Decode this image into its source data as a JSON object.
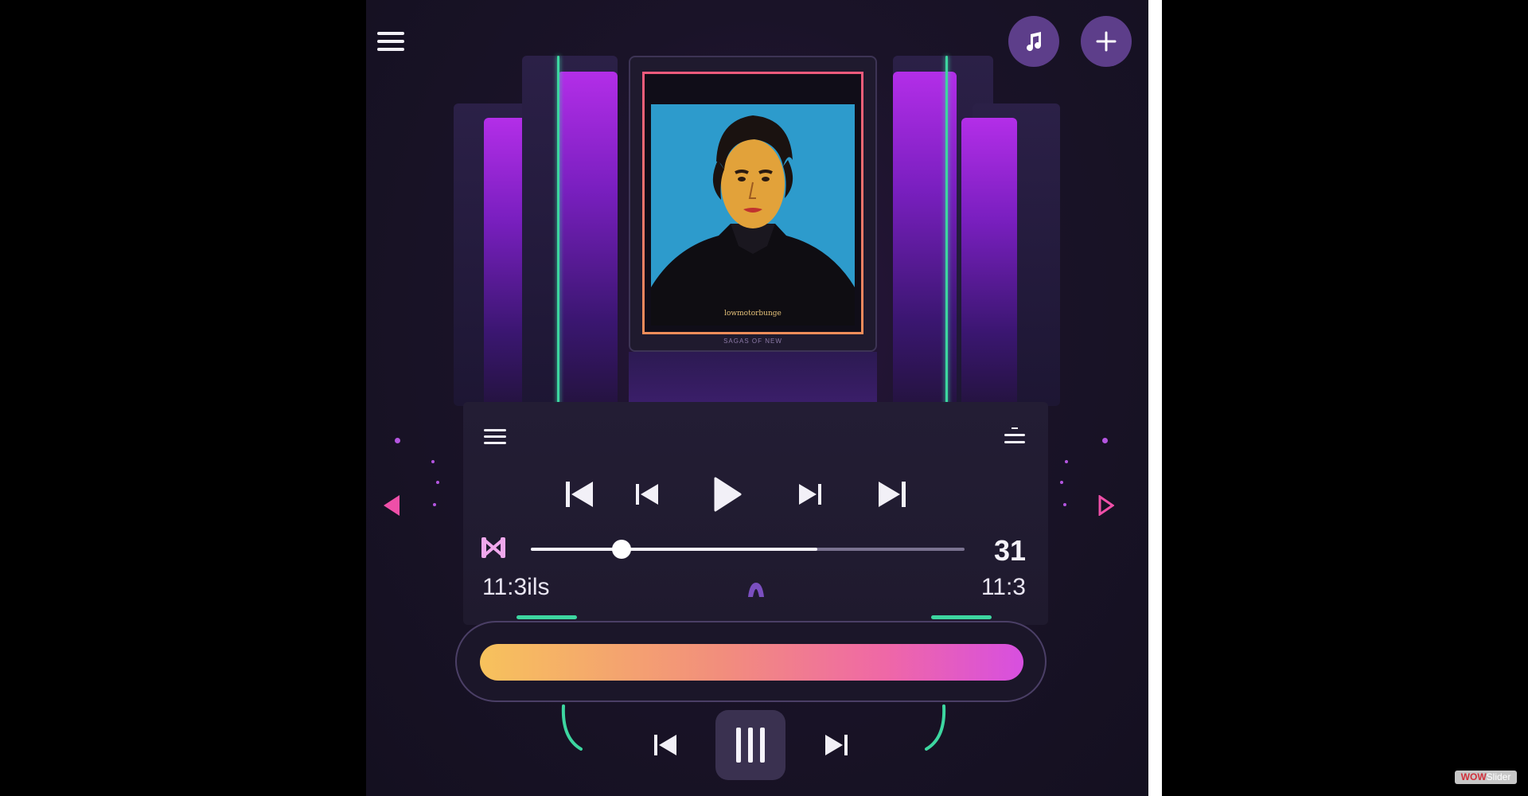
{
  "player": {
    "album_caption": "lowmotorbunge",
    "frame_subtitle": "SAGAS OF NEW",
    "counter": "31",
    "time_elapsed": "11:3ils",
    "time_total": "11:3",
    "progress_fraction": 0.21,
    "buffer_fraction": 0.66
  },
  "watermark": {
    "part1": "WOW",
    "part2": "Slider"
  },
  "colors": {
    "accent_green": "#3dd6a0",
    "accent_purple": "#b32ee8",
    "accent_pink": "#ef5fb0",
    "round_button": "#5d3e8a"
  },
  "icons": [
    "menu-icon",
    "music-note-icon",
    "plus-icon",
    "playlist-icon",
    "queue-icon",
    "skip-to-start-icon",
    "previous-icon",
    "play-icon",
    "next-icon",
    "skip-to-end-icon",
    "shuffle-icon",
    "tag-icon",
    "pause-icon",
    "arrow-left-icon",
    "arrow-right-icon"
  ]
}
